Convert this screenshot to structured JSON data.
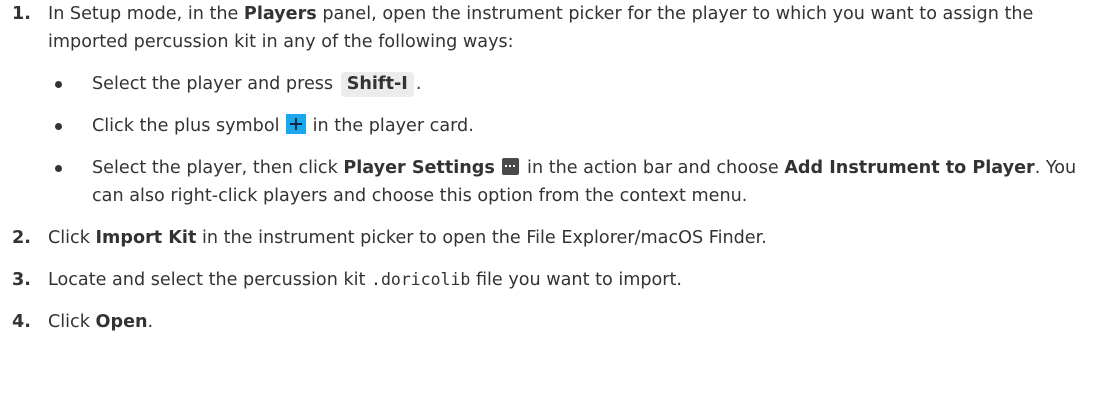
{
  "steps": [
    {
      "num": "1.",
      "t1": "In Setup mode, in the ",
      "b1": "Players",
      "t2": " panel, open the instrument picker for the player to which you want to assign the imported percussion kit in any of the following ways:",
      "bullets": [
        {
          "t1": "Select the player and press ",
          "kbd": "Shift-I",
          "t2": "."
        },
        {
          "t1": "Click the plus symbol ",
          "icon": "plus-icon",
          "t2": " in the player card."
        },
        {
          "t1": "Select the player, then click ",
          "b1": "Player Settings",
          "icon": "player-settings-icon",
          "t2": " in the action bar and choose ",
          "b2": "Add Instrument to Player",
          "t3": ". You can also right-click players and choose this option from the context menu."
        }
      ]
    },
    {
      "num": "2.",
      "t1": "Click ",
      "b1": "Import Kit",
      "t2": " in the instrument picker to open the File Explorer/macOS Finder."
    },
    {
      "num": "3.",
      "t1": "Locate and select the percussion kit ",
      "code": ".doricolib",
      "t2": " file you want to import."
    },
    {
      "num": "4.",
      "t1": "Click ",
      "b1": "Open",
      "t2": "."
    }
  ],
  "colors": {
    "text": "#333333",
    "plus_icon_bg": "#1aa7ec",
    "settings_icon_bg": "#4a4a4a",
    "kbd_bg": "#ececec"
  }
}
